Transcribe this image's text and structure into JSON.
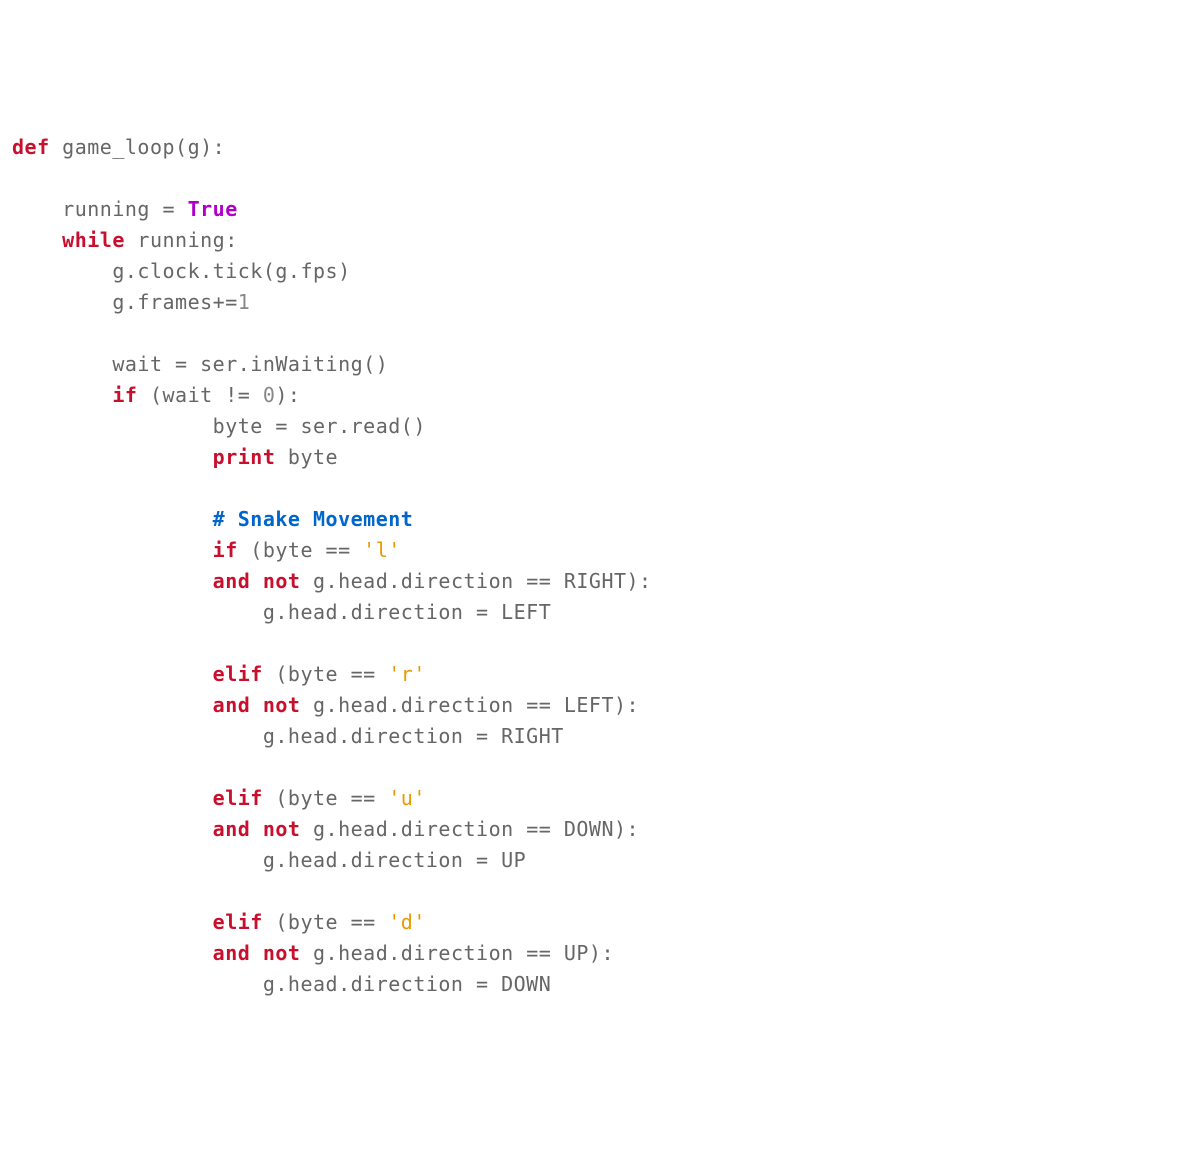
{
  "code": {
    "tokens": [
      {
        "t": "def ",
        "c": "kw-def"
      },
      {
        "t": "game_loop(g):"
      },
      {
        "t": "\n"
      },
      {
        "t": "\n"
      },
      {
        "t": "    running = "
      },
      {
        "t": "True",
        "c": "literal"
      },
      {
        "t": "\n"
      },
      {
        "t": "    "
      },
      {
        "t": "while",
        "c": "kw-ctrl"
      },
      {
        "t": " running:\n"
      },
      {
        "t": "        g.clock.tick(g.fps)\n"
      },
      {
        "t": "        g.frames+="
      },
      {
        "t": "1",
        "c": "num"
      },
      {
        "t": "\n"
      },
      {
        "t": "\n"
      },
      {
        "t": "        wait = ser.inWaiting()\n"
      },
      {
        "t": "        "
      },
      {
        "t": "if",
        "c": "kw-ctrl"
      },
      {
        "t": " (wait != "
      },
      {
        "t": "0",
        "c": "num"
      },
      {
        "t": "):\n"
      },
      {
        "t": "                byte = ser.read()\n"
      },
      {
        "t": "                "
      },
      {
        "t": "print",
        "c": "kw-print"
      },
      {
        "t": " byte\n"
      },
      {
        "t": "\n"
      },
      {
        "t": "                "
      },
      {
        "t": "# Snake Movement",
        "c": "comment"
      },
      {
        "t": "\n"
      },
      {
        "t": "                "
      },
      {
        "t": "if",
        "c": "kw-ctrl"
      },
      {
        "t": " (byte == "
      },
      {
        "t": "'l'",
        "c": "string"
      },
      {
        "t": "\n"
      },
      {
        "t": "                "
      },
      {
        "t": "and not",
        "c": "kw-ctrl"
      },
      {
        "t": " g.head.direction == RIGHT):\n"
      },
      {
        "t": "                    g.head.direction = LEFT\n"
      },
      {
        "t": "\n"
      },
      {
        "t": "                "
      },
      {
        "t": "elif",
        "c": "kw-ctrl"
      },
      {
        "t": " (byte == "
      },
      {
        "t": "'r'",
        "c": "string"
      },
      {
        "t": "\n"
      },
      {
        "t": "                "
      },
      {
        "t": "and not",
        "c": "kw-ctrl"
      },
      {
        "t": " g.head.direction == LEFT):\n"
      },
      {
        "t": "                    g.head.direction = RIGHT\n"
      },
      {
        "t": "\n"
      },
      {
        "t": "                "
      },
      {
        "t": "elif",
        "c": "kw-ctrl"
      },
      {
        "t": " (byte == "
      },
      {
        "t": "'u'",
        "c": "string"
      },
      {
        "t": "\n"
      },
      {
        "t": "                "
      },
      {
        "t": "and not",
        "c": "kw-ctrl"
      },
      {
        "t": " g.head.direction == DOWN):\n"
      },
      {
        "t": "                    g.head.direction = UP\n"
      },
      {
        "t": "\n"
      },
      {
        "t": "                "
      },
      {
        "t": "elif",
        "c": "kw-ctrl"
      },
      {
        "t": " (byte == "
      },
      {
        "t": "'d'",
        "c": "string"
      },
      {
        "t": "\n"
      },
      {
        "t": "                "
      },
      {
        "t": "and not",
        "c": "kw-ctrl"
      },
      {
        "t": " g.head.direction == UP):\n"
      },
      {
        "t": "                    g.head.direction = DOWN\n"
      }
    ]
  }
}
